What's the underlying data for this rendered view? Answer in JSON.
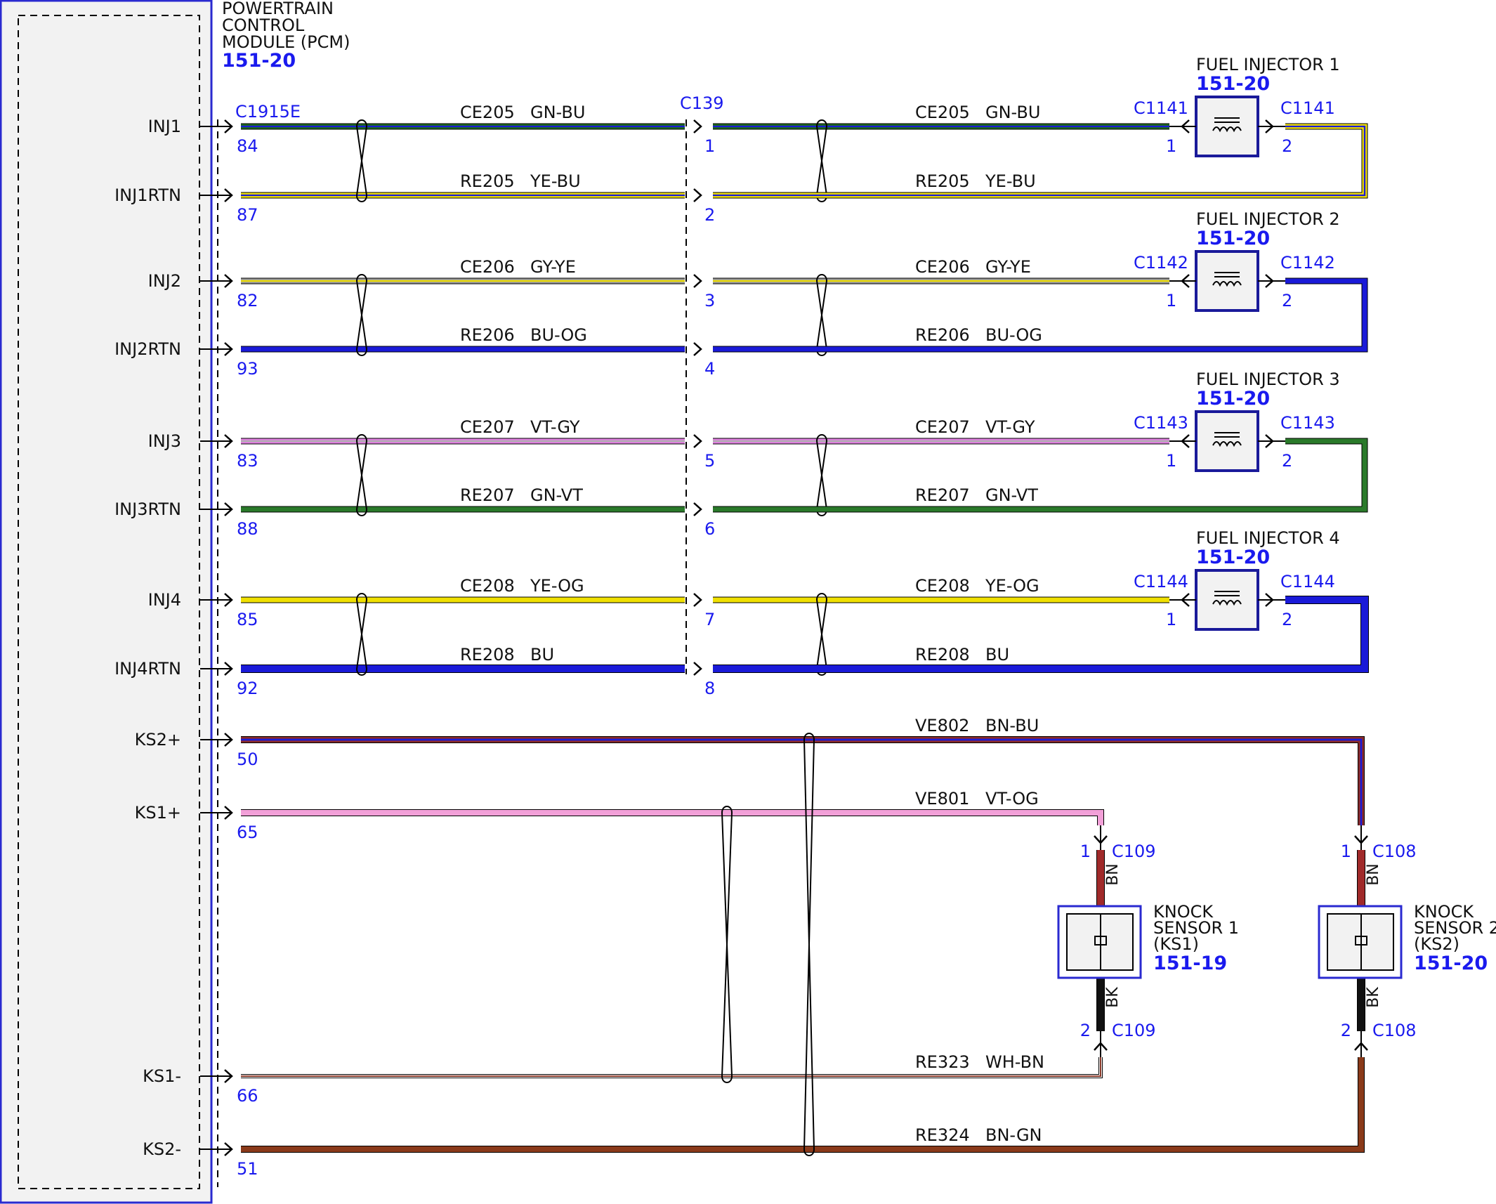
{
  "pcm": {
    "title_lines": [
      "POWERTRAIN",
      "CONTROL",
      "MODULE (PCM)"
    ],
    "ref": "151-20",
    "connector": "C1915E"
  },
  "inline_connector": "C139",
  "injector_circuits": [
    {
      "pin": "INJ1",
      "pcm_pin": "84",
      "c139_pin": "1",
      "circuit": "CE205",
      "color_code": "GN-BU",
      "colors": [
        "#1e6b1e",
        "#1a1ad8"
      ],
      "inj_side": "1"
    },
    {
      "pin": "INJ1RTN",
      "pcm_pin": "87",
      "c139_pin": "2",
      "circuit": "RE205",
      "color_code": "YE-BU",
      "colors": [
        "#f0e000",
        "#1a1ad8"
      ],
      "inj_side": "2"
    },
    {
      "pin": "INJ2",
      "pcm_pin": "82",
      "c139_pin": "3",
      "circuit": "CE206",
      "color_code": "GY-YE",
      "colors": [
        "#9a9a9a",
        "#f0e000"
      ],
      "inj_side": "1"
    },
    {
      "pin": "INJ2RTN",
      "pcm_pin": "93",
      "c139_pin": "4",
      "circuit": "RE206",
      "color_code": "BU-OG",
      "colors": [
        "#1a1ad8",
        "#1a1ad8"
      ],
      "inj_side": "2"
    },
    {
      "pin": "INJ3",
      "pcm_pin": "83",
      "c139_pin": "5",
      "circuit": "CE207",
      "color_code": "VT-GY",
      "colors": [
        "#e080e0",
        "#b0b0b0"
      ],
      "inj_side": "1"
    },
    {
      "pin": "INJ3RTN",
      "pcm_pin": "88",
      "c139_pin": "6",
      "circuit": "RE207",
      "color_code": "GN-VT",
      "colors": [
        "#2a7a2a",
        "#2a7a2a"
      ],
      "inj_side": "2"
    },
    {
      "pin": "INJ4",
      "pcm_pin": "85",
      "c139_pin": "7",
      "circuit": "CE208",
      "color_code": "YE-OG",
      "colors": [
        "#f0e000",
        "#f0e000"
      ],
      "inj_side": "1"
    },
    {
      "pin": "INJ4RTN",
      "pcm_pin": "92",
      "c139_pin": "8",
      "circuit": "RE208",
      "color_code": "BU",
      "colors": [
        "#1a1ad8",
        "#1a1ad8"
      ],
      "inj_side": "2"
    }
  ],
  "injectors": [
    {
      "name": "FUEL INJECTOR 1",
      "ref": "151-20",
      "connector": "C1141",
      "pin_in": "1",
      "pin_out": "2"
    },
    {
      "name": "FUEL INJECTOR 2",
      "ref": "151-20",
      "connector": "C1142",
      "pin_in": "1",
      "pin_out": "2"
    },
    {
      "name": "FUEL INJECTOR 3",
      "ref": "151-20",
      "connector": "C1143",
      "pin_in": "1",
      "pin_out": "2"
    },
    {
      "name": "FUEL INJECTOR 4",
      "ref": "151-20",
      "connector": "C1144",
      "pin_in": "1",
      "pin_out": "2"
    }
  ],
  "knock_circuits": [
    {
      "pin": "KS2+",
      "pcm_pin": "50",
      "circuit": "VE802",
      "color_code": "BN-BU",
      "colors": [
        "#8a2a2a",
        "#1a1ad8"
      ]
    },
    {
      "pin": "KS1+",
      "pcm_pin": "65",
      "circuit": "VE801",
      "color_code": "VT-OG",
      "colors": [
        "#f2a0d8",
        "#f2a0d8"
      ]
    },
    {
      "pin": "KS1-",
      "pcm_pin": "66",
      "circuit": "RE323",
      "color_code": "WH-BN",
      "colors": [
        "#ffffff",
        "#8a3a2a"
      ]
    },
    {
      "pin": "KS2-",
      "pcm_pin": "51",
      "circuit": "RE324",
      "color_code": "BN-GN",
      "colors": [
        "#8a3a1a",
        "#8a3a1a"
      ]
    }
  ],
  "knock_sensors": [
    {
      "name_lines": [
        "KNOCK",
        "SENSOR 1",
        "(KS1)"
      ],
      "ref": "151-19",
      "connector": "C109",
      "pin1": "1",
      "pin2": "2",
      "wire_top": "BN",
      "wire_bottom": "BK"
    },
    {
      "name_lines": [
        "KNOCK",
        "SENSOR 2",
        "(KS2)"
      ],
      "ref": "151-20",
      "connector": "C108",
      "pin1": "1",
      "pin2": "2",
      "wire_top": "BN",
      "wire_bottom": "BK"
    }
  ],
  "colors": {
    "label_blue": "#1a1aee",
    "frame_blue": "#2a2ad0",
    "module_bg": "#f2f2f2"
  }
}
